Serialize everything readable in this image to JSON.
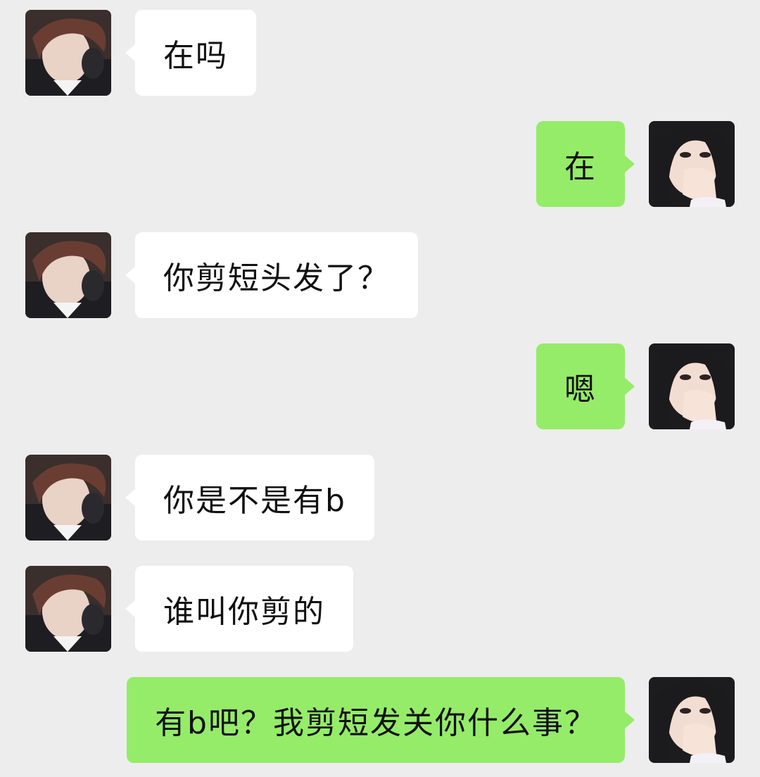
{
  "theme": {
    "background": "#ededed",
    "incoming_bubble": "#ffffff",
    "outgoing_bubble": "#95ec69"
  },
  "messages": [
    {
      "side": "left",
      "text": "在吗",
      "avatar": "boy-avatar"
    },
    {
      "side": "right",
      "text": "在",
      "avatar": "girl-avatar"
    },
    {
      "side": "left",
      "text": "你剪短头发了？",
      "avatar": "boy-avatar"
    },
    {
      "side": "right",
      "text": "嗯",
      "avatar": "girl-avatar"
    },
    {
      "side": "left",
      "text": "你是不是有b",
      "avatar": "boy-avatar"
    },
    {
      "side": "left",
      "text": "谁叫你剪的",
      "avatar": "boy-avatar"
    },
    {
      "side": "right",
      "text": "有b吧？我剪短发关你什么事？",
      "avatar": "girl-avatar"
    }
  ]
}
